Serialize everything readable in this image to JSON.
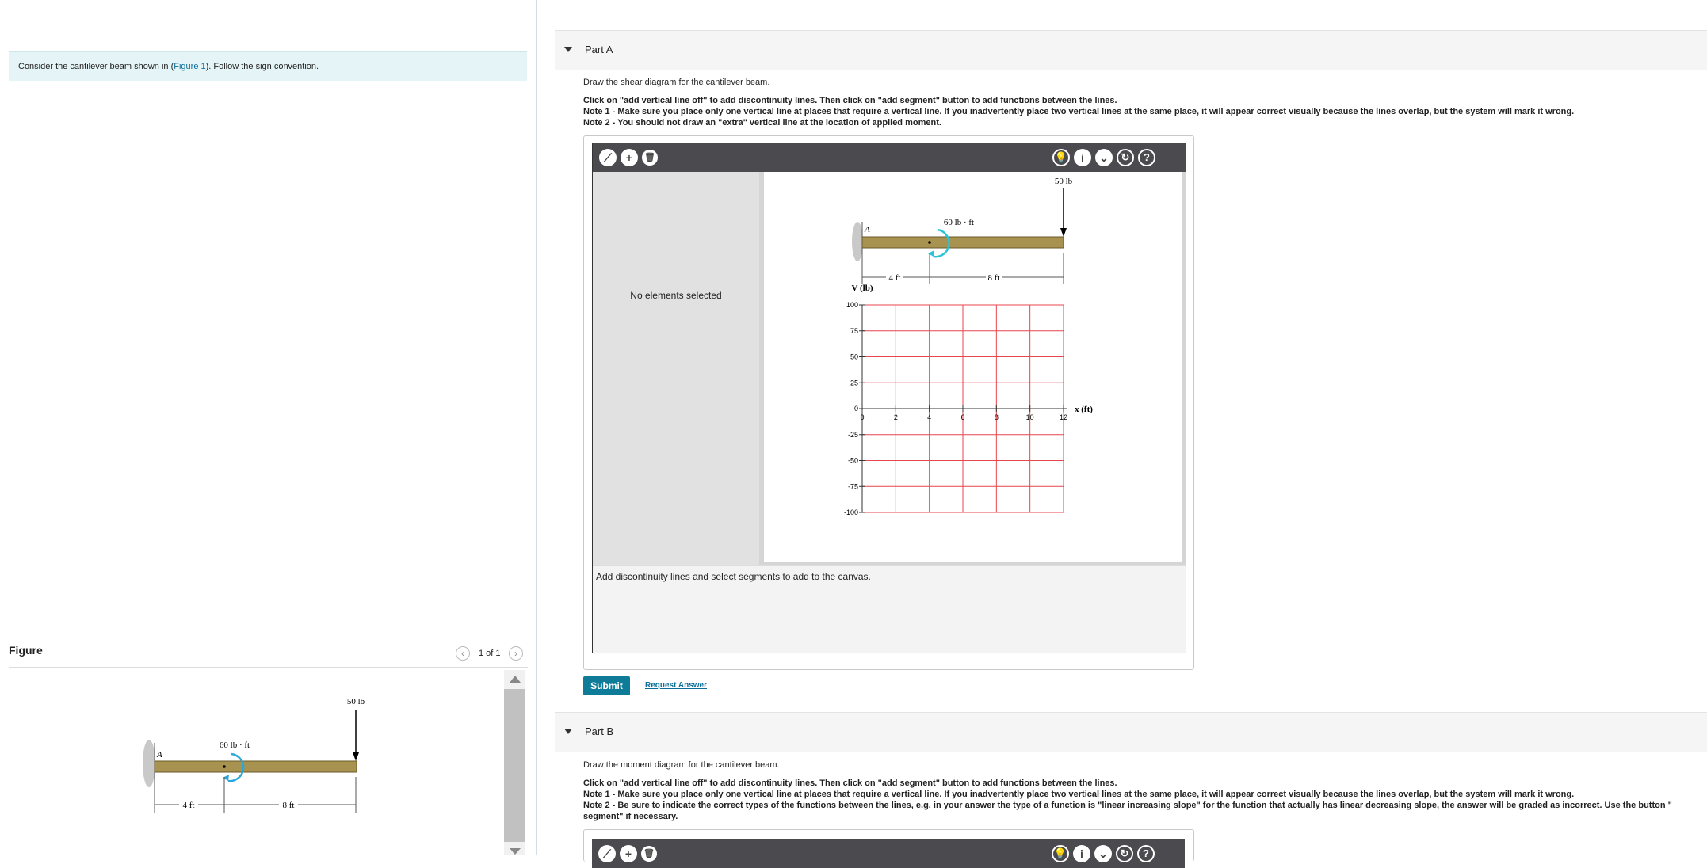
{
  "problem": {
    "intro_before": "Consider the cantilever beam shown in (",
    "figure_link": "Figure 1",
    "intro_after": "). Follow the sign convention."
  },
  "figure_panel": {
    "title": "Figure",
    "pager": "1 of 1",
    "prev_icon": "chevron-left-icon",
    "next_icon": "chevron-right-icon"
  },
  "beam": {
    "support_label": "A",
    "moment_label": "60 lb · ft",
    "force_label": "50 lb",
    "dim1": "4 ft",
    "dim2": "8 ft"
  },
  "part_a": {
    "title": "Part A",
    "instruction": "Draw the shear diagram for the cantilever beam.",
    "line1": "Click on \"add vertical line off\" to add discontinuity lines. Then click on \"add segment\" button to add functions between the lines.",
    "note1": "Note 1 - Make sure you place only one vertical line at places that require a vertical line. If you inadvertently place two vertical lines at the same place, it will appear correct visually because the lines overlap, but the system will mark it wrong.",
    "note2": "Note 2 - You should not draw an \"extra\" vertical line at the location of applied moment.",
    "toolbar_icons": [
      "vertical-line-icon",
      "plus-icon",
      "trash-icon"
    ],
    "right_icons": [
      "lightbulb-icon",
      "info-icon",
      "chevron-down-icon",
      "reset-icon",
      "help-icon"
    ],
    "no_selection": "No elements selected",
    "status": "Add discontinuity lines and select segments to add to the canvas.",
    "submit": "Submit",
    "request_answer": "Request Answer"
  },
  "part_b": {
    "title": "Part B",
    "instruction": "Draw the moment diagram for the cantilever beam.",
    "line1": "Click on \"add vertical line off\" to add discontinuity lines. Then click on \"add segment\" button to add functions between the lines.",
    "note1": "Note 1 - Make sure you place only one vertical line at places that require a vertical line. If you inadvertently place two vertical lines at the same place, it will appear correct visually because the lines overlap, but the system will mark it wrong.",
    "note2": "Note 2 - Be sure to indicate the correct types of the functions between the lines, e.g. in your answer the type of a function is \"linear increasing slope\" for the function that actually has linear decreasing slope, the answer will be graded as incorrect. Use the button \"",
    "note2_cont": "segment\" if necessary."
  },
  "chart_data": {
    "type": "line",
    "ylabel": "V (lb)",
    "xlabel": "x (ft)",
    "xlim": [
      0,
      12
    ],
    "ylim": [
      -100,
      100
    ],
    "x_ticks": [
      "0",
      "2",
      "4",
      "6",
      "8",
      "10",
      "12"
    ],
    "y_ticks": [
      "100",
      "75",
      "50",
      "25",
      "0",
      "-25",
      "-50",
      "-75",
      "-100"
    ],
    "grid": true,
    "grid_color": "#e8454d",
    "series": []
  }
}
